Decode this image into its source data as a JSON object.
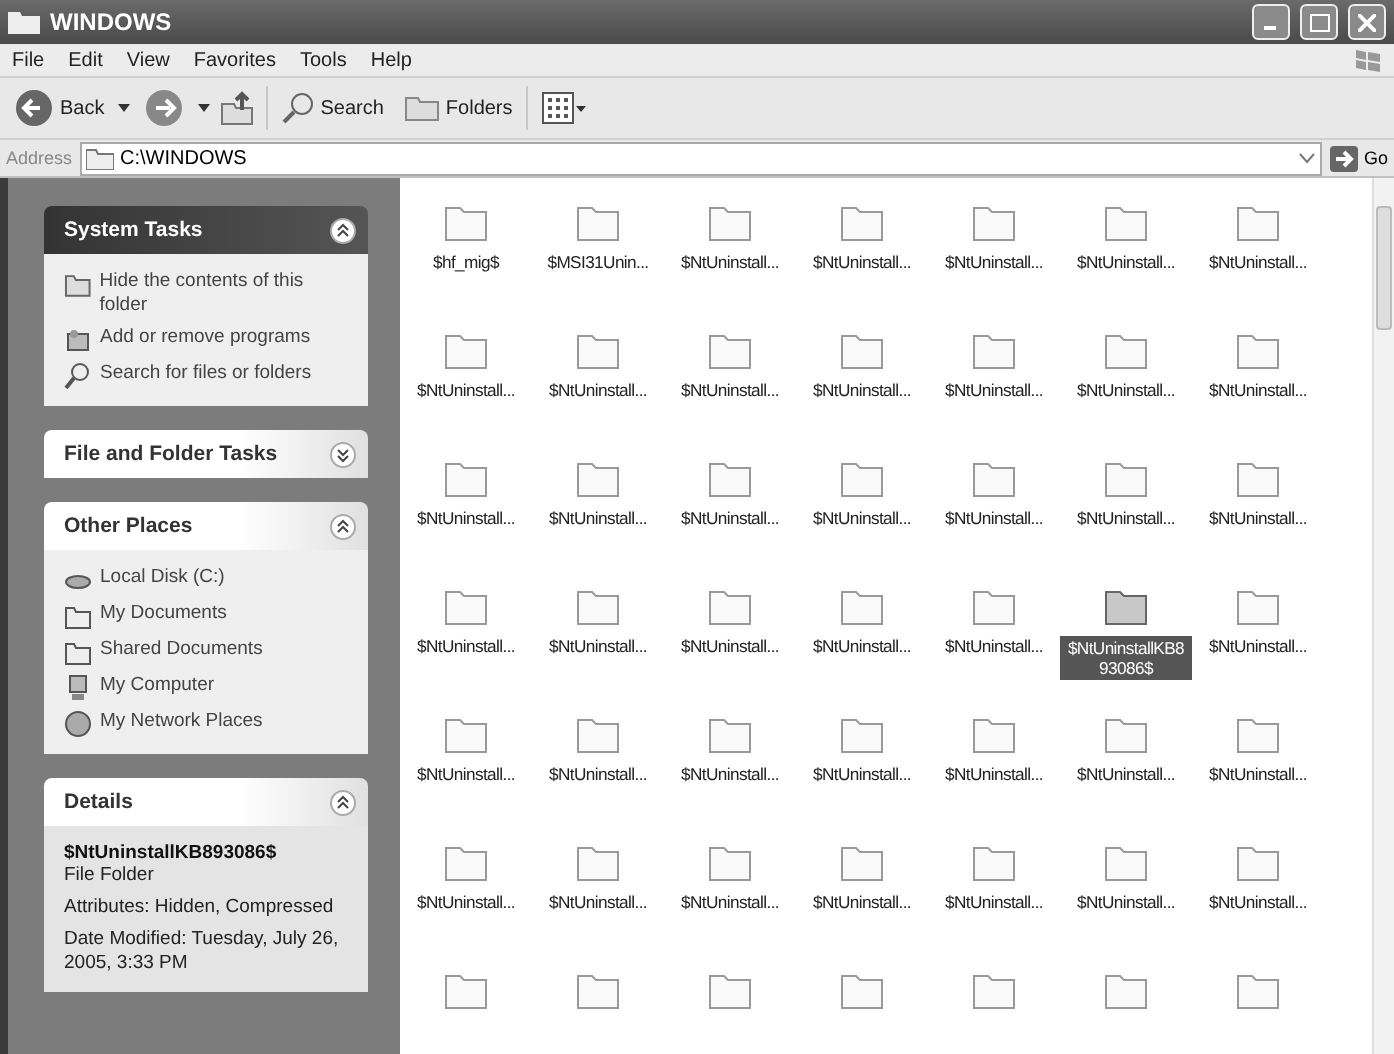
{
  "window": {
    "title": "WINDOWS"
  },
  "menu": [
    "File",
    "Edit",
    "View",
    "Favorites",
    "Tools",
    "Help"
  ],
  "toolbar": {
    "back": "Back",
    "search": "Search",
    "folders": "Folders"
  },
  "address": {
    "label": "Address",
    "value": "C:\\WINDOWS",
    "go": "Go"
  },
  "panels": [
    {
      "kind": "special",
      "title": "System Tasks",
      "expanded": true,
      "links": [
        "Hide the contents of this folder",
        "Add or remove programs",
        "Search for files or folders"
      ]
    },
    {
      "kind": "normal",
      "title": "File and Folder Tasks",
      "expanded": false
    },
    {
      "kind": "normal",
      "title": "Other Places",
      "expanded": true,
      "links": [
        "Local Disk (C:)",
        "My Documents",
        "Shared Documents",
        "My Computer",
        "My Network Places"
      ]
    },
    {
      "kind": "details",
      "title": "Details",
      "expanded": true,
      "name": "$NtUninstallKB893086$",
      "type": "File Folder",
      "lines": [
        "Attributes: Hidden, Compressed",
        "Date Modified: Tuesday, July 26, 2005, 3:33 PM"
      ]
    }
  ],
  "items": [
    {
      "label": "$hf_mig$",
      "selected": false
    },
    {
      "label": "$MSI31Unin...",
      "selected": false
    },
    {
      "label": "$NtUninstall...",
      "selected": false
    },
    {
      "label": "$NtUninstall...",
      "selected": false
    },
    {
      "label": "$NtUninstall...",
      "selected": false
    },
    {
      "label": "$NtUninstall...",
      "selected": false
    },
    {
      "label": "$NtUninstall...",
      "selected": false
    },
    {
      "label": "$NtUninstall...",
      "selected": false
    },
    {
      "label": "$NtUninstall...",
      "selected": false
    },
    {
      "label": "$NtUninstall...",
      "selected": false
    },
    {
      "label": "$NtUninstall...",
      "selected": false
    },
    {
      "label": "$NtUninstall...",
      "selected": false
    },
    {
      "label": "$NtUninstall...",
      "selected": false
    },
    {
      "label": "$NtUninstall...",
      "selected": false
    },
    {
      "label": "$NtUninstall...",
      "selected": false
    },
    {
      "label": "$NtUninstall...",
      "selected": false
    },
    {
      "label": "$NtUninstall...",
      "selected": false
    },
    {
      "label": "$NtUninstall...",
      "selected": false
    },
    {
      "label": "$NtUninstall...",
      "selected": false
    },
    {
      "label": "$NtUninstall...",
      "selected": false
    },
    {
      "label": "$NtUninstall...",
      "selected": false
    },
    {
      "label": "$NtUninstall...",
      "selected": false
    },
    {
      "label": "$NtUninstall...",
      "selected": false
    },
    {
      "label": "$NtUninstall...",
      "selected": false
    },
    {
      "label": "$NtUninstall...",
      "selected": false
    },
    {
      "label": "$NtUninstall...",
      "selected": false
    },
    {
      "label": "$NtUninstallKB893086$",
      "selected": true
    },
    {
      "label": "$NtUninstall...",
      "selected": false
    },
    {
      "label": "$NtUninstall...",
      "selected": false
    },
    {
      "label": "$NtUninstall...",
      "selected": false
    },
    {
      "label": "$NtUninstall...",
      "selected": false
    },
    {
      "label": "$NtUninstall...",
      "selected": false
    },
    {
      "label": "$NtUninstall...",
      "selected": false
    },
    {
      "label": "$NtUninstall...",
      "selected": false
    },
    {
      "label": "$NtUninstall...",
      "selected": false
    },
    {
      "label": "$NtUninstall...",
      "selected": false
    },
    {
      "label": "$NtUninstall...",
      "selected": false
    },
    {
      "label": "$NtUninstall...",
      "selected": false
    },
    {
      "label": "$NtUninstall...",
      "selected": false
    },
    {
      "label": "$NtUninstall...",
      "selected": false
    },
    {
      "label": "$NtUninstall...",
      "selected": false
    },
    {
      "label": "$NtUninstall...",
      "selected": false
    },
    {
      "selected": false
    },
    {
      "selected": false
    },
    {
      "selected": false
    },
    {
      "selected": false
    },
    {
      "selected": false
    },
    {
      "selected": false
    },
    {
      "selected": false
    }
  ]
}
